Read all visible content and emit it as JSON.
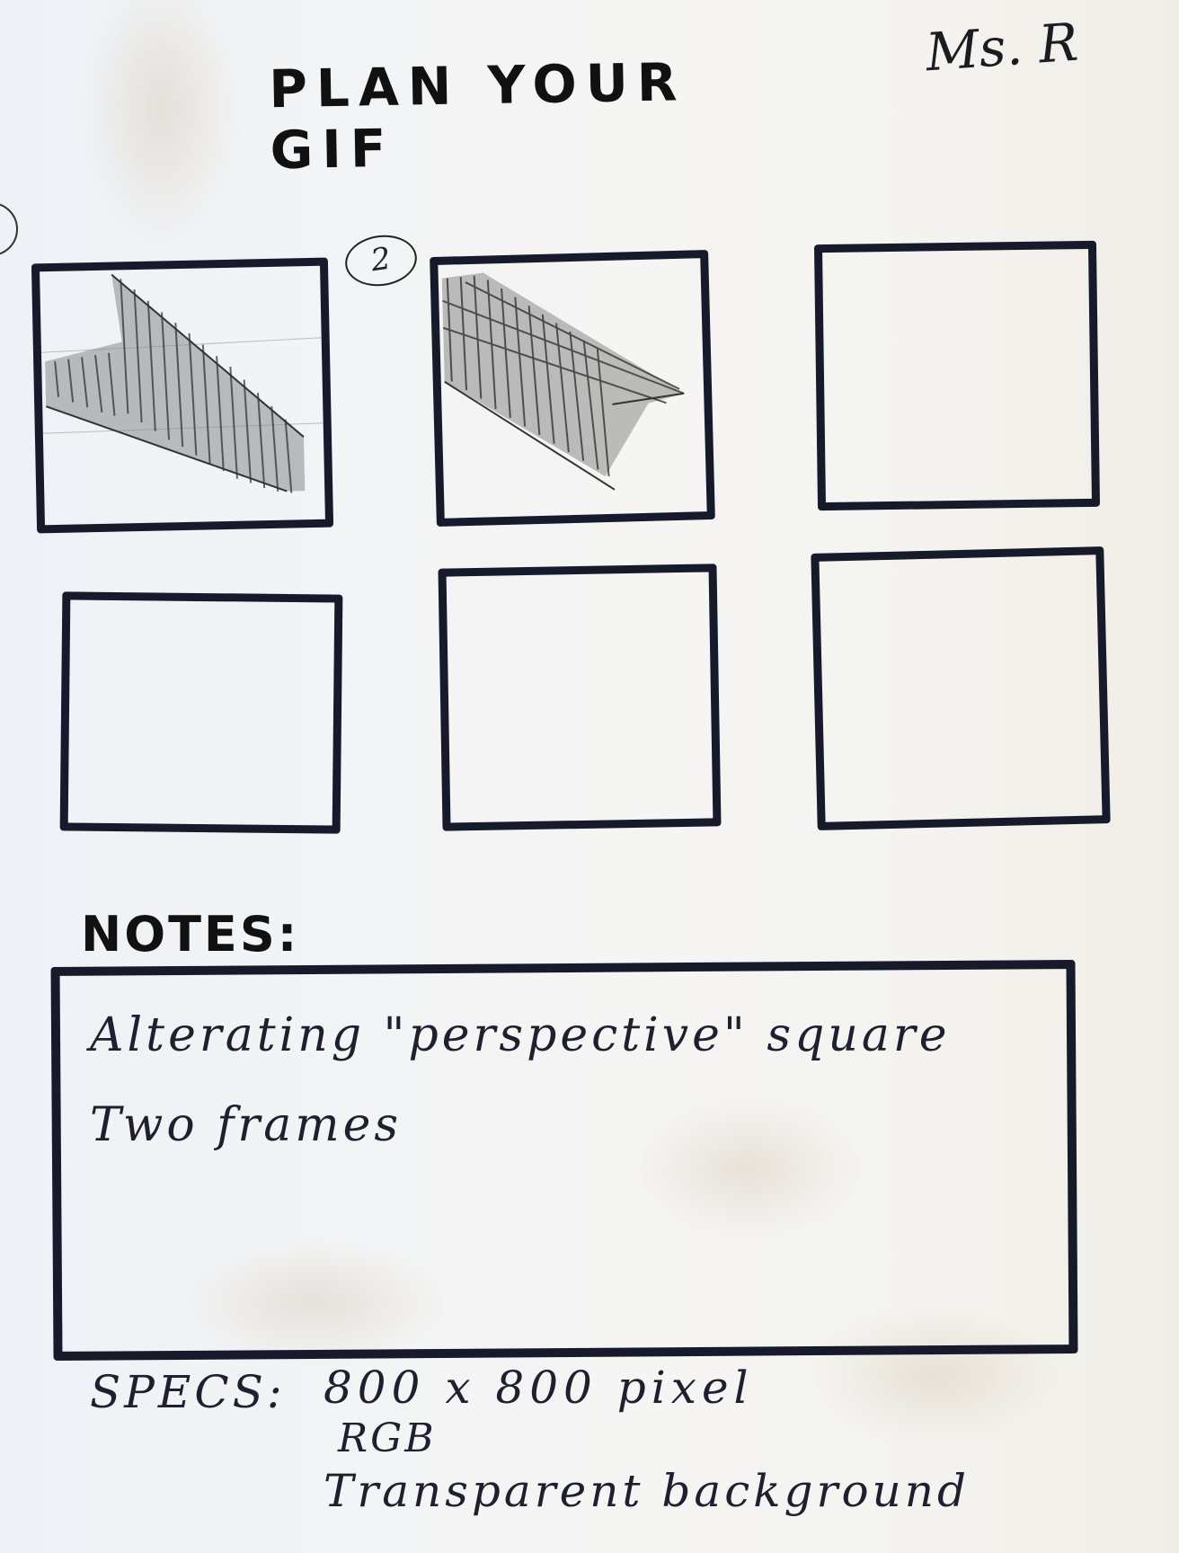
{
  "title": "PLAN YOUR GIF",
  "author": "Ms. R",
  "frames": {
    "number_label": "2"
  },
  "notes": {
    "label": "NOTES:",
    "lines": [
      "Alterating \"perspective\" square",
      "Two frames"
    ]
  },
  "specs": {
    "label": "SPECS:",
    "items": [
      "800 x 800 pixel",
      "RGB",
      "Transparent background"
    ]
  }
}
